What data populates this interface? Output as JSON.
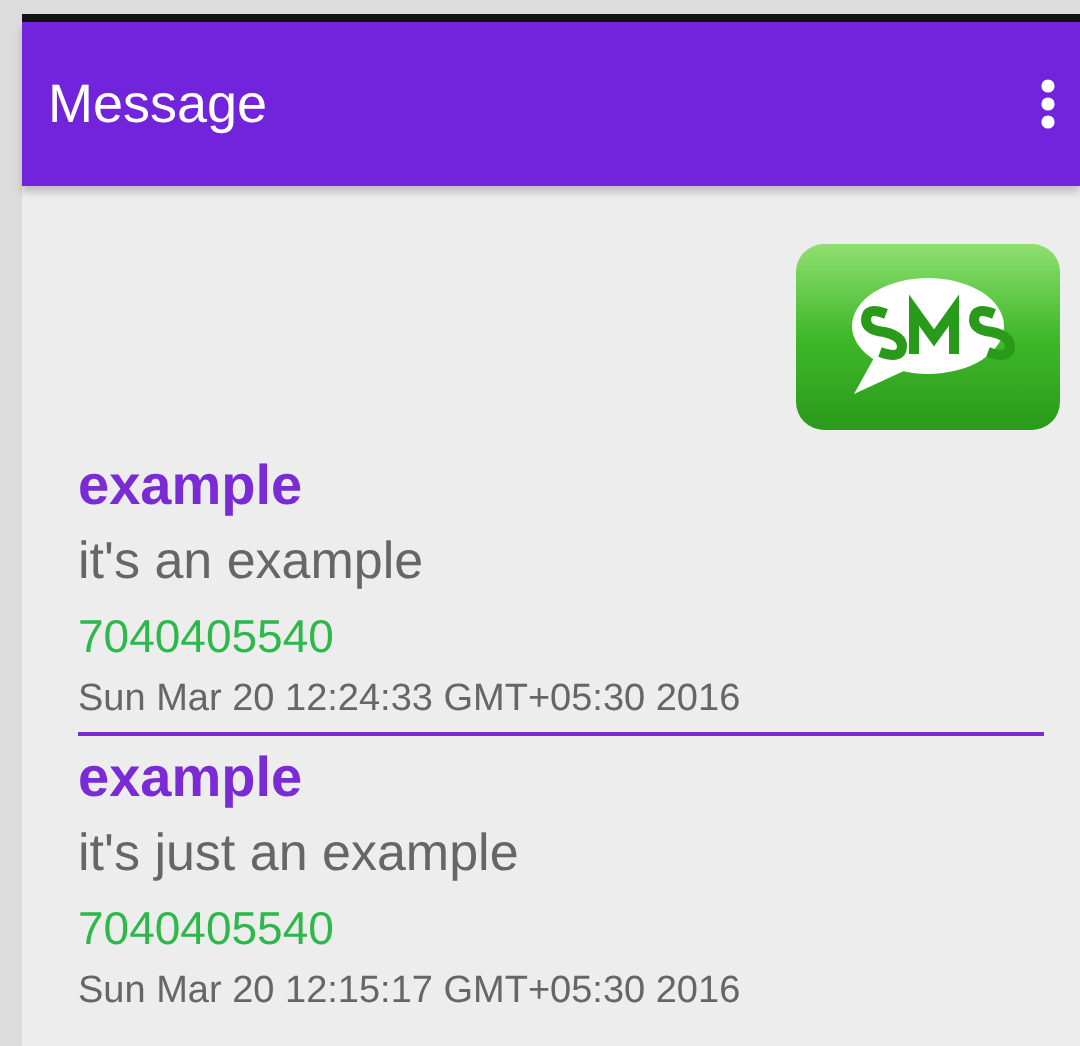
{
  "app_bar": {
    "title": "Message"
  },
  "messages": [
    {
      "sender": "example",
      "body": "it's an example",
      "number": "7040405540",
      "date": "Sun Mar 20 12:24:33 GMT+05:30 2016"
    },
    {
      "sender": "example",
      "body": "it's just an example",
      "number": "7040405540",
      "date": "Sun Mar 20 12:15:17 GMT+05:30 2016"
    }
  ]
}
